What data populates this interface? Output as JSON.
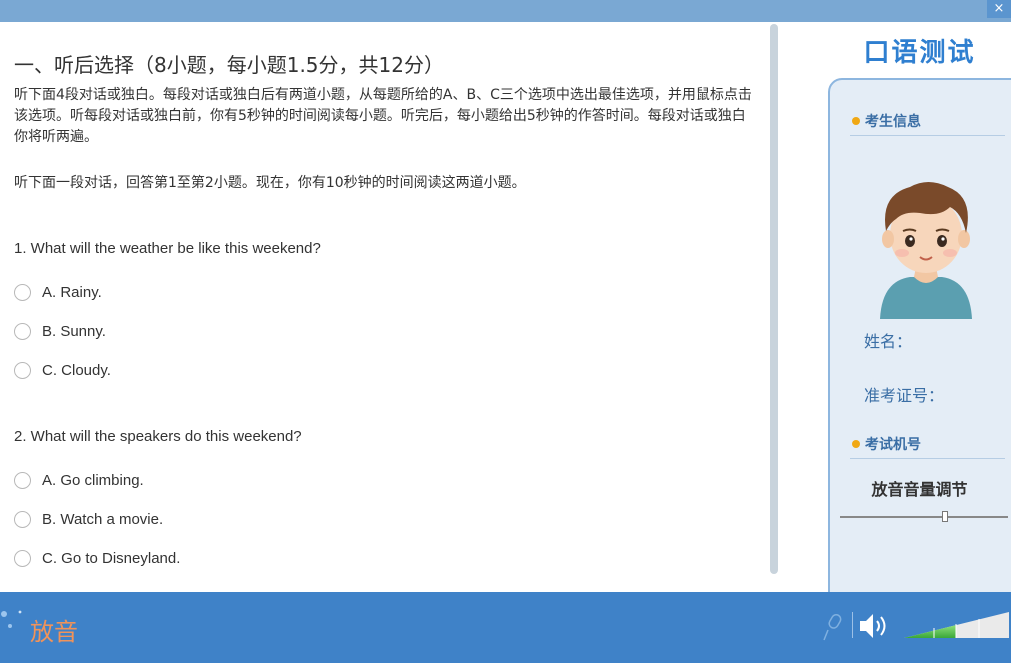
{
  "window": {
    "close_glyph": "×"
  },
  "section": {
    "title": "一、听后选择（8小题，每小题1.5分，共12分）",
    "instructions": "听下面4段对话或独白。每段对话或独白后有两道小题，从每题所给的A、B、C三个选项中选出最佳选项，并用鼠标点击该选项。听每段对话或独白前，你有5秒钟的时间阅读每小题。听完后，每小题给出5秒钟的作答时间。每段对话或独白你将听两遍。",
    "sub_instruction": "听下面一段对话，回答第1至第2小题。现在，你有10秒钟的时间阅读这两道小题。"
  },
  "questions": [
    {
      "text": "1. What will the weather be like this weekend?",
      "options": [
        "A. Rainy.",
        "B. Sunny.",
        "C. Cloudy."
      ]
    },
    {
      "text": "2. What will the speakers do this weekend?",
      "options": [
        "A. Go climbing.",
        "B. Watch a movie.",
        "C. Go to Disneyland."
      ]
    }
  ],
  "sidebar": {
    "title": "口语测试",
    "candidate_info_heading": "考生信息",
    "name_label": "姓名：",
    "exam_id_label": "准考证号：",
    "machine_heading": "考试机号",
    "volume_label": "放音音量调节",
    "volume_level": 0.63
  },
  "bottom": {
    "play_label": "放音",
    "output_level": 0.5
  },
  "colors": {
    "accent": "#2f7fd0",
    "bottom_bar": "#3f82c8",
    "play_label": "#f0935a",
    "bullet": "#f0a814"
  }
}
